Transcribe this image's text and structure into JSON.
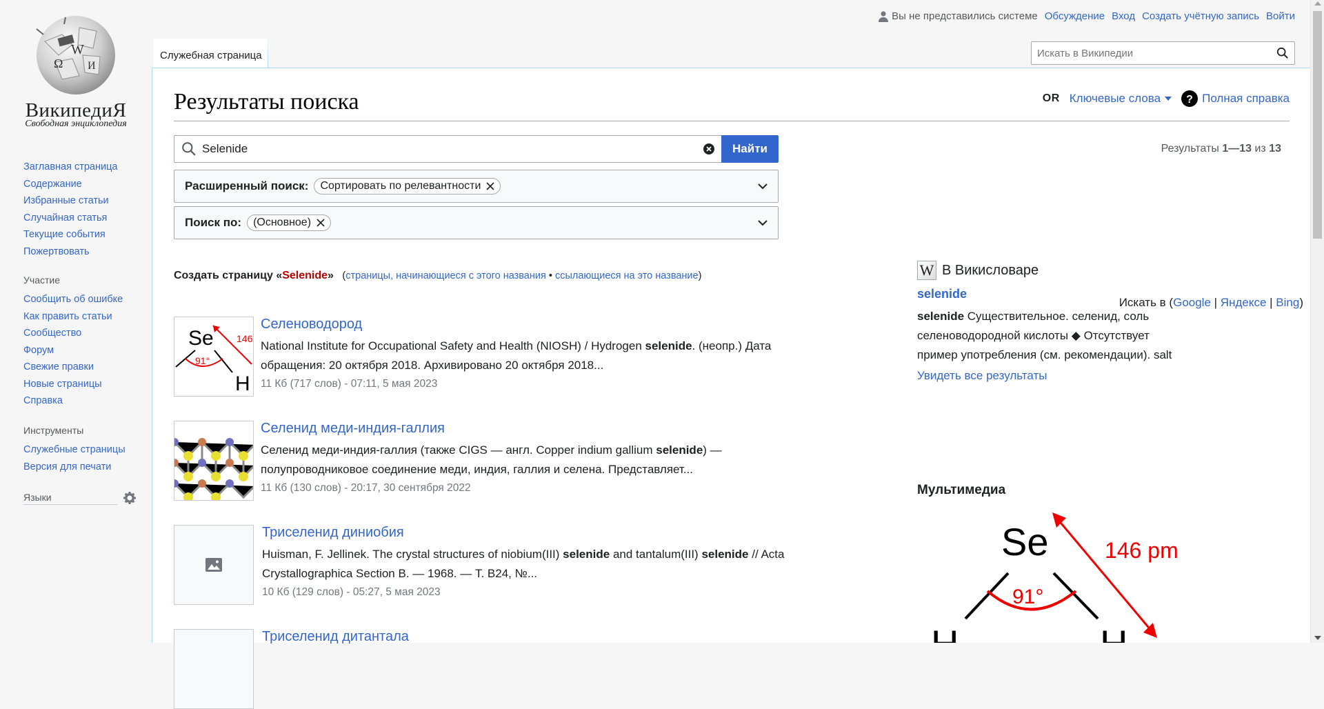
{
  "logo": {
    "wordmark": "ВикипедиЯ",
    "tagline": "Свободная энциклопедия",
    "globe_glyphs": [
      "W",
      "Ω",
      "И"
    ]
  },
  "nav_main": [
    "Заглавная страница",
    "Содержание",
    "Избранные статьи",
    "Случайная статья",
    "Текущие события",
    "Пожертвовать"
  ],
  "nav_participation": {
    "heading": "Участие",
    "items": [
      "Сообщить об ошибке",
      "Как править статьи",
      "Сообщество",
      "Форум",
      "Свежие правки",
      "Новые страницы",
      "Справка"
    ]
  },
  "nav_tools": {
    "heading": "Инструменты",
    "items": [
      "Служебные страницы",
      "Версия для печати"
    ]
  },
  "nav_languages": {
    "heading": "Языки"
  },
  "personal": {
    "not_logged": "Вы не представились системе",
    "talk": "Обсуждение",
    "login": "Вход",
    "create_account": "Создать учётную запись",
    "logout": "Войти"
  },
  "tabs": {
    "special": "Служебная страница"
  },
  "top_search": {
    "placeholder": "Искать в Википедии"
  },
  "heading": "Результаты поиска",
  "indicators": {
    "or": "OR",
    "keywords": "Ключевые слова",
    "help": "Полная справка",
    "help_glyph": "?"
  },
  "search": {
    "value": "Selenide",
    "submit": "Найти"
  },
  "advanced": {
    "label": "Расширенный поиск:",
    "chip": "Сортировать по релевантности"
  },
  "namespace": {
    "label": "Поиск по:",
    "chip": "(Основное)"
  },
  "results_info": {
    "prefix": "Результаты ",
    "range": "1—13",
    "mid": " из ",
    "total": "13"
  },
  "create": {
    "prefix": "Создать страницу «",
    "title": "Selenide",
    "suffix": "»",
    "open": "(",
    "link1": "страницы, начинающиеся с этого названия",
    "sep": " • ",
    "link2": "ссылающиеся на это название",
    "close": ")"
  },
  "interwiki": {
    "prefix": "Искать в (",
    "google": "Google",
    "yandex": "Яндексе",
    "bing": "Bing",
    "sep": " | ",
    "suffix": ")"
  },
  "results": [
    {
      "title": "Селеноводород",
      "snippet_parts": [
        "National Institute for Occupational Safety and Health (NIOSH) / Hydrogen ",
        "selenide",
        ".  (неопр.) Дата обращения: 20 октября 2018. Архивировано 20 октября 2018..."
      ],
      "meta": "11 Кб (717 слов) - 07:11, 5 мая 2023",
      "thumb_labels": {
        "se": "Se",
        "h": "H",
        "angle": "91°",
        "dist": "146"
      }
    },
    {
      "title": "Селенид меди-индия-галлия",
      "snippet_parts": [
        "Селенид меди-индия-галлия (также CIGS — англ. Copper indium gallium ",
        "selenide",
        ") — полупроводниковое соединение меди, индия, галлия и селена. Представляет..."
      ],
      "meta": "11 Кб (130 слов) - 20:17, 30 сентября 2022"
    },
    {
      "title": "Триселенид диниобия",
      "snippet_parts": [
        "Huisman, F. Jellinek. The crystal structures of niobium(III) ",
        "selenide",
        " and tantalum(III) ",
        "selenide",
        " // Acta Crystallographica Section B. — 1968. — Т. B24, №..."
      ],
      "meta": "10 Кб (129 слов) - 05:27, 5 мая 2023"
    },
    {
      "title": "Триселенид дитантала"
    }
  ],
  "sister": {
    "header": "В Викисловаре",
    "icon_glyph": "W",
    "title": "selenide",
    "snippet_bold": "selenide",
    "snippet_rest": " Существительное. селенид, соль селеноводородной кислоты ◆ Отсутствует пример употребления (см. рекомендации). salt",
    "more": "Увидеть все результаты"
  },
  "multimedia": {
    "header": "Мультимедиа",
    "se": "Se",
    "h": "H",
    "angle": "91°",
    "dist": "146 pm"
  },
  "colors": {
    "link": "#3366cc",
    "red_link": "#ba0000",
    "button": "#3366cc",
    "border": "#a2a9b1"
  }
}
